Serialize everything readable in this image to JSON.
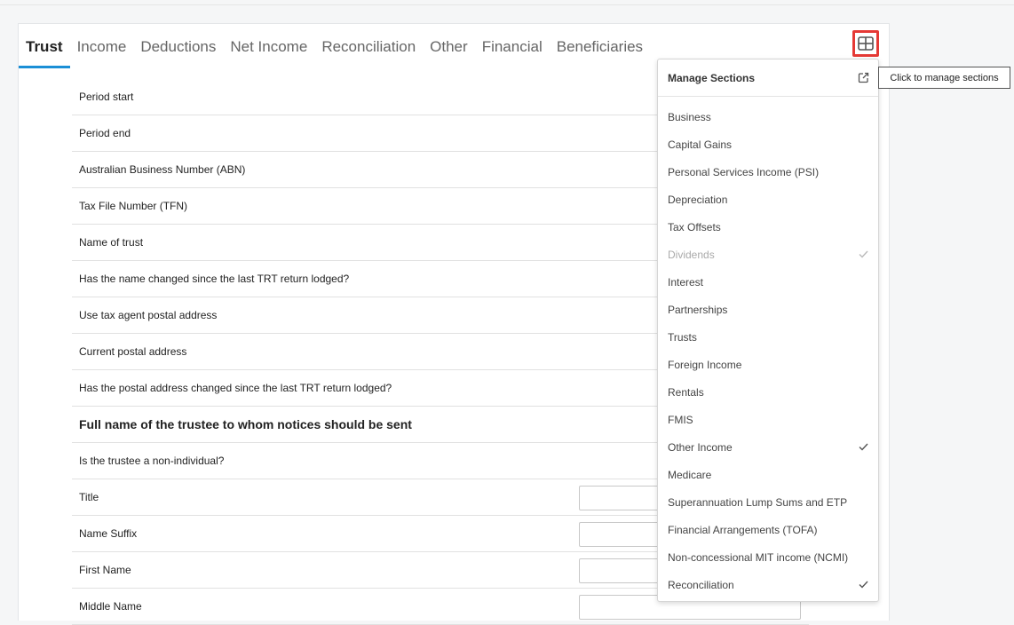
{
  "tabs": [
    {
      "label": "Trust",
      "active": true
    },
    {
      "label": "Income"
    },
    {
      "label": "Deductions"
    },
    {
      "label": "Net Income"
    },
    {
      "label": "Reconciliation"
    },
    {
      "label": "Other"
    },
    {
      "label": "Financial"
    },
    {
      "label": "Beneficiaries"
    }
  ],
  "manage_button": {
    "icon": "grid-icon",
    "tooltip": "Click to manage sections"
  },
  "form": {
    "rows": [
      {
        "label": "Period start"
      },
      {
        "label": "Period end"
      },
      {
        "label": "Australian Business Number (ABN)"
      },
      {
        "label": "Tax File Number (TFN)"
      },
      {
        "label": "Name of trust"
      },
      {
        "label": "Has the name changed since the last TRT return lodged?"
      },
      {
        "label": "Use tax agent postal address"
      },
      {
        "label": "Current postal address"
      },
      {
        "label": "Has the postal address changed since the last TRT return lodged?"
      },
      {
        "label": "Full name of the trustee to whom notices should be sent"
      },
      {
        "label": "Is the trustee a non-individual?"
      },
      {
        "label": "Title"
      },
      {
        "label": "Name Suffix"
      },
      {
        "label": "First Name"
      },
      {
        "label": "Middle Name"
      }
    ]
  },
  "manage_sections": {
    "title": "Manage Sections",
    "items": [
      {
        "label": "Business",
        "checked": false
      },
      {
        "label": "Capital Gains",
        "checked": false
      },
      {
        "label": "Personal Services Income (PSI)",
        "checked": false
      },
      {
        "label": "Depreciation",
        "checked": false
      },
      {
        "label": "Tax Offsets",
        "checked": false
      },
      {
        "label": "Dividends",
        "checked": true,
        "disabled": true
      },
      {
        "label": "Interest",
        "checked": false
      },
      {
        "label": "Partnerships",
        "checked": false
      },
      {
        "label": "Trusts",
        "checked": false
      },
      {
        "label": "Foreign Income",
        "checked": false
      },
      {
        "label": "Rentals",
        "checked": false
      },
      {
        "label": "FMIS",
        "checked": false
      },
      {
        "label": "Other Income",
        "checked": true
      },
      {
        "label": "Medicare",
        "checked": false
      },
      {
        "label": "Superannuation Lump Sums and ETP",
        "checked": false
      },
      {
        "label": "Financial Arrangements (TOFA)",
        "checked": false
      },
      {
        "label": "Non-concessional MIT income (NCMI)",
        "checked": false
      },
      {
        "label": "Reconciliation",
        "checked": true
      }
    ]
  },
  "colors": {
    "accent": "#1b8fd6",
    "highlight": "#e53935"
  }
}
